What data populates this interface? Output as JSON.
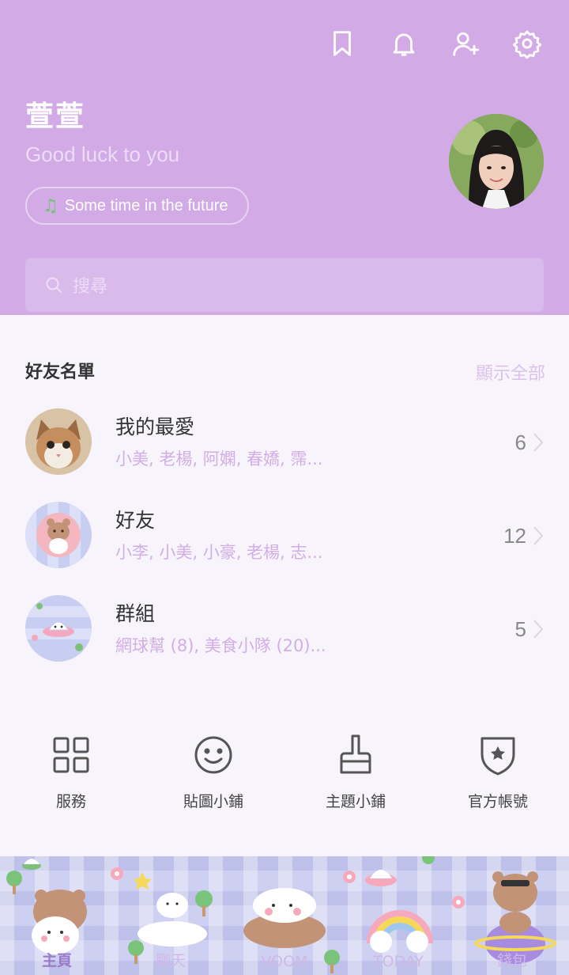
{
  "profile": {
    "name": "萱萱",
    "status_message": "Good luck to you",
    "music": "Some time in the future"
  },
  "search": {
    "placeholder": "搜尋"
  },
  "friends": {
    "section_title": "好友名單",
    "show_all": "顯示全部",
    "rows": [
      {
        "title": "我的最愛",
        "subtitle": "小美, 老楊, 阿嫻, 春嬌, 霈...",
        "count": "6",
        "avatar": "cat-photo"
      },
      {
        "title": "好友",
        "subtitle": "小李, 小美, 小豪, 老楊, 志...",
        "count": "12",
        "avatar": "bear-sticker"
      },
      {
        "title": "群組",
        "subtitle": "網球幫 (8), 美食小隊 (20)...",
        "count": "5",
        "avatar": "ufo-sticker"
      }
    ]
  },
  "services": [
    {
      "label": "服務",
      "icon": "grid-icon"
    },
    {
      "label": "貼圖小鋪",
      "icon": "smiley-icon"
    },
    {
      "label": "主題小鋪",
      "icon": "brush-icon"
    },
    {
      "label": "官方帳號",
      "icon": "shield-star-icon"
    }
  ],
  "tabs": [
    {
      "label": "主頁",
      "active": true
    },
    {
      "label": "聊天",
      "active": false
    },
    {
      "label": "VOOM",
      "active": false
    },
    {
      "label": "TODAY",
      "active": false
    },
    {
      "label": "錢包",
      "active": false
    }
  ],
  "colors": {
    "header": "#d2aae6",
    "accent_text": "#d2aee6",
    "tabbar": "#ced0f1"
  }
}
